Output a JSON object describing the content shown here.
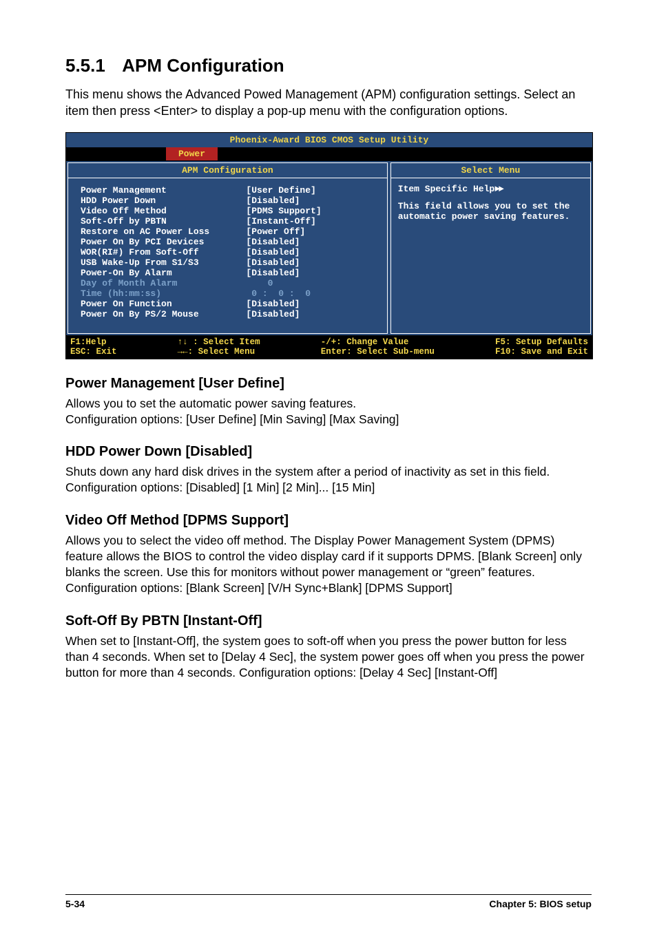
{
  "section": {
    "number": "5.5.1",
    "title": "APM Configuration",
    "intro": "This menu shows the Advanced Powed Management (APM) configuration settings. Select an item then press <Enter> to display a pop-up menu with the configuration options."
  },
  "bios": {
    "title": "Phoenix-Award BIOS CMOS Setup Utility",
    "tab_active": "Power",
    "main_header": "APM Configuration",
    "side_header": "Select Menu",
    "labels": [
      "Power Management",
      "HDD Power Down",
      "Video Off Method",
      "Soft-Off by PBTN",
      "Restore on AC Power Loss",
      "Power On By PCI Devices",
      "WOR(RI#) From Soft-Off",
      "USB Wake-Up From S1/S3",
      "Power-On By Alarm",
      "Day of Month Alarm",
      "Time (hh:mm:ss)",
      "Power On Function",
      "Power On By PS/2 Mouse"
    ],
    "values": [
      "[User Define]",
      "[Disabled]",
      "[PDMS Support]",
      "[Instant-Off]",
      "[Power Off]",
      "[Disabled]",
      "[Disabled]",
      "[Disabled]",
      "[Disabled]",
      "    0",
      " 0 :  0 :  0",
      "[Disabled]",
      "[Disabled]"
    ],
    "dim_rows": [
      9,
      10
    ],
    "help_head": "Item Specific Help",
    "help_body": "This field allows you to set the automatic power saving features.",
    "footer": {
      "f1": "F1:Help",
      "esc": "ESC: Exit",
      "sel_item": "↑↓ : Select Item",
      "sel_menu": "→←: Select Menu",
      "change": "-/+: Change Value",
      "enter": "Enter: Select Sub-menu",
      "f5": "F5: Setup Defaults",
      "f10": "F10: Save and Exit"
    }
  },
  "subs": [
    {
      "heading": "Power Management [User Define]",
      "text": "Allows you to set the automatic power saving features.\nConfiguration options: [User Define] [Min Saving] [Max Saving]"
    },
    {
      "heading": "HDD Power Down [Disabled]",
      "text": "Shuts down any hard disk drives in the system after a period of inactivity as set in this field.\nConfiguration options: [Disabled] [1 Min] [2 Min]... [15 Min]"
    },
    {
      "heading": "Video Off Method [DPMS Support]",
      "text": "Allows you to select the video off method. The Display Power Management System (DPMS) feature allows the BIOS to control the video display card if it supports DPMS. [Blank Screen] only blanks the screen. Use this for monitors without power management or “green” features.\nConfiguration options: [Blank Screen] [V/H Sync+Blank] [DPMS Support]"
    },
    {
      "heading": "Soft-Off By PBTN [Instant-Off]",
      "text": "When set to [Instant-Off], the system goes to soft-off when you press the power button for less than 4 seconds. When set to [Delay 4 Sec], the system power goes off when you press the power button for more than 4 seconds. Configuration options: [Delay 4 Sec] [Instant-Off]"
    }
  ],
  "page_footer": {
    "left": "5-34",
    "right": "Chapter 5: BIOS setup"
  }
}
